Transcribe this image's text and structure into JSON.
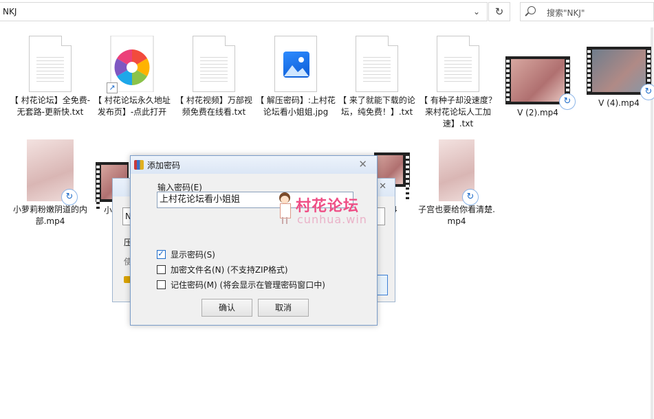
{
  "address_bar": {
    "path": "NKJ",
    "search_placeholder": "搜索\"NKJ\""
  },
  "files": [
    {
      "name": "【 村花论坛】全免费-无套路-更新快.txt",
      "type": "txt",
      "icon": "text-document-icon"
    },
    {
      "name": "【 村花论坛永久地址发布页】-点此打开",
      "type": "shortcut",
      "icon": "colorful-pinwheel-shortcut-icon"
    },
    {
      "name": "【 村花视频】万部视频免费在线看.txt",
      "type": "txt",
      "icon": "text-document-icon"
    },
    {
      "name": "【 解压密码】:上村花论坛看小姐姐.jpg",
      "type": "jpg",
      "icon": "image-document-icon"
    },
    {
      "name": "【 来了就能下载的论坛，纯免费！】.txt",
      "type": "txt",
      "icon": "text-document-icon"
    },
    {
      "name": "【 有种子却没速度？来村花论坛人工加速】.txt",
      "type": "txt",
      "icon": "text-document-icon"
    },
    {
      "name": "V (2).mp4",
      "type": "mp4",
      "icon": "video-thumbnail-icon"
    },
    {
      "name": "V (4).mp4",
      "type": "mp4",
      "icon": "video-thumbnail-icon"
    },
    {
      "name": "小萝莉粉嫩阴道的内部.mp4",
      "type": "mp4",
      "icon": "video-thumbnail-icon"
    },
    {
      "name": "小",
      "type": "mp4",
      "icon": "video-thumbnail-icon"
    },
    {
      "name": "p4",
      "type": "mp4",
      "icon": "video-thumbnail-icon"
    },
    {
      "name": "子宫也要给你看清楚.mp4",
      "type": "mp4",
      "icon": "video-thumbnail-icon"
    }
  ],
  "back_dialog": {
    "field_text": "N",
    "label1": "压",
    "label2": "使"
  },
  "dialog": {
    "title": "添加密码",
    "password_label": "输入密码(E)",
    "password_value": "上村花论坛看小姐姐",
    "options": [
      {
        "label": "显示密码(S)",
        "checked": true
      },
      {
        "label": "加密文件名(N) (不支持ZIP格式)",
        "checked": false
      },
      {
        "label": "记住密码(M) (将会显示在管理密码窗口中)",
        "checked": false
      }
    ],
    "ok_label": "确认",
    "cancel_label": "取消"
  },
  "watermark": {
    "title": "村花论坛",
    "subtitle": "cunhua.win",
    "color": "#ef4f86"
  }
}
